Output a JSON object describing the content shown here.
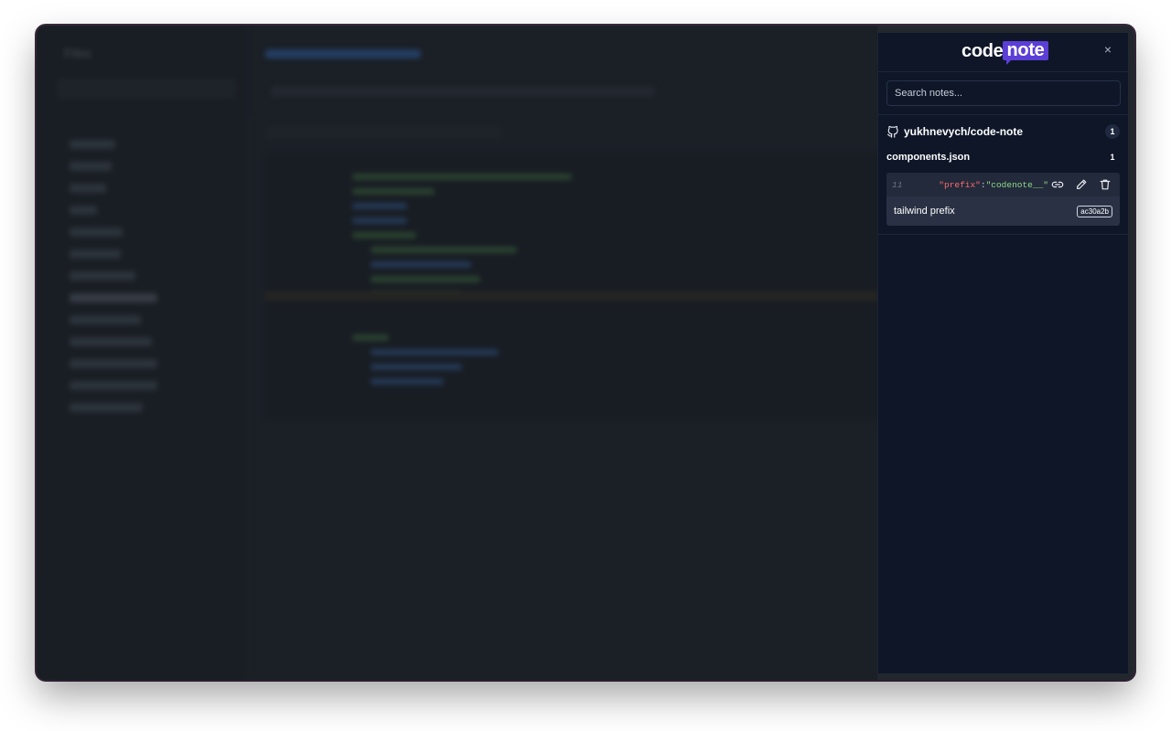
{
  "background_app": {
    "title": "Files"
  },
  "panel": {
    "logo": {
      "part1": "code",
      "part2": "note"
    },
    "close_label": "×",
    "search": {
      "placeholder": "Search notes...",
      "value": ""
    },
    "repo": {
      "name": "yukhnevych/code-note",
      "count": "1",
      "files": [
        {
          "name": "components.json",
          "count": "1",
          "notes": [
            {
              "line": "11",
              "code_key": "\"prefix\"",
              "code_colon": ": ",
              "code_value": "\"codenote__\"",
              "text": "tailwind prefix",
              "commit": "ac30a2b"
            }
          ]
        }
      ]
    },
    "icons": {
      "repo": "github-icon",
      "link": "link-icon",
      "edit": "pencil-icon",
      "delete": "trash-icon",
      "close": "close-icon"
    },
    "colors": {
      "accent": "#5b3fd6",
      "panel_bg": "#0e1628",
      "code_key": "#ff6b6b",
      "code_value": "#8dd88a"
    }
  }
}
